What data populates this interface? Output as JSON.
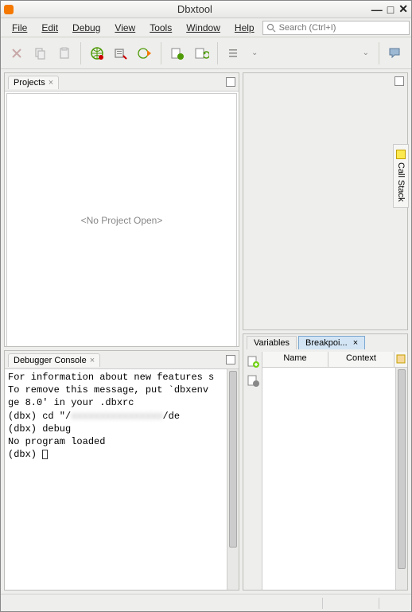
{
  "window": {
    "title": "Dbxtool"
  },
  "menu": {
    "file": "File",
    "edit": "Edit",
    "debug": "Debug",
    "view": "View",
    "tools": "Tools",
    "window": "Window",
    "help": "Help"
  },
  "search": {
    "placeholder": "Search (Ctrl+I)"
  },
  "projects": {
    "tab": "Projects",
    "empty": "<No Project Open>"
  },
  "console": {
    "tab": "Debugger Console",
    "lines": [
      "For information about new features s",
      "To remove this message, put `dbxenv",
      "ge 8.0' in your .dbxrc",
      "(dbx) cd \"/",
      "(dbx) debug",
      "No program loaded",
      "(dbx) "
    ],
    "redacted_tail": "/de"
  },
  "vars": {
    "tab_variables": "Variables",
    "tab_breakpoints": "Breakpoi...",
    "col_name": "Name",
    "col_context": "Context"
  },
  "callstack": {
    "label": "Call Stack"
  },
  "icons": {
    "cut": "cut-icon",
    "copy": "copy-icon",
    "paste": "paste-icon",
    "globe": "debug-globe-icon",
    "config": "debug-config-icon",
    "run": "run-icon",
    "step": "step-icon",
    "restart": "restart-icon",
    "dropdown": "dropdown-icon",
    "chat": "chat-bubble-icon"
  },
  "colors": {
    "bg": "#eeeeec",
    "activeTab": "#d3e5f5",
    "accent": "#f57900"
  }
}
